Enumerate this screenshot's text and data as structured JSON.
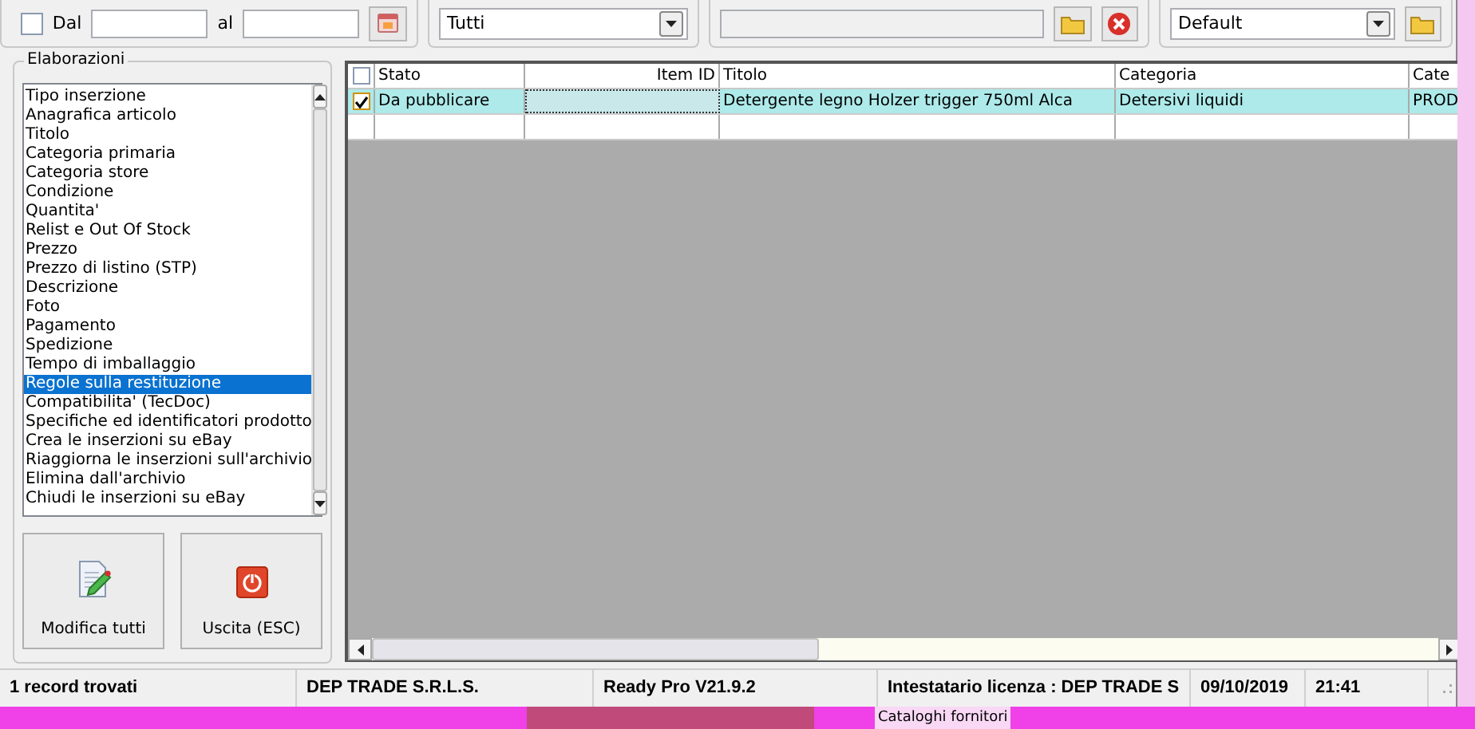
{
  "date_filter": {
    "from_label": "Dal",
    "checked": false,
    "to_label": "al"
  },
  "variant": {
    "value": "Tutti"
  },
  "view": {
    "value": "Default"
  },
  "elaborazioni": {
    "title": "Elaborazioni",
    "items": [
      {
        "label": "Tipo inserzione",
        "selected": false
      },
      {
        "label": "Anagrafica articolo",
        "selected": false
      },
      {
        "label": "Titolo",
        "selected": false
      },
      {
        "label": "Categoria primaria",
        "selected": false
      },
      {
        "label": "Categoria store",
        "selected": false
      },
      {
        "label": "Condizione",
        "selected": false
      },
      {
        "label": "Quantita'",
        "selected": false
      },
      {
        "label": "Relist e Out Of Stock",
        "selected": false
      },
      {
        "label": "Prezzo",
        "selected": false
      },
      {
        "label": "Prezzo di listino (STP)",
        "selected": false
      },
      {
        "label": "Descrizione",
        "selected": false
      },
      {
        "label": "Foto",
        "selected": false
      },
      {
        "label": "Pagamento",
        "selected": false
      },
      {
        "label": "Spedizione",
        "selected": false
      },
      {
        "label": "Tempo di imballaggio",
        "selected": false
      },
      {
        "label": "Regole sulla restituzione",
        "selected": true
      },
      {
        "label": "Compatibilita' (TecDoc)",
        "selected": false
      },
      {
        "label": "Specifiche ed identificatori prodotto",
        "selected": false
      },
      {
        "label": "Crea le inserzioni su eBay",
        "selected": false
      },
      {
        "label": "Riaggiorna le inserzioni sull'archivio",
        "selected": false
      },
      {
        "label": "Elimina dall'archivio",
        "selected": false
      },
      {
        "label": "Chiudi le inserzioni su eBay",
        "selected": false
      }
    ]
  },
  "buttons": [
    {
      "kind": "edit",
      "label": "Modifica tutti"
    },
    {
      "kind": "exit",
      "label": "Uscita (ESC)"
    }
  ],
  "table": {
    "header_checked": false,
    "columns": [
      "Stato",
      "Item ID",
      "Titolo",
      "Categoria",
      "Cate"
    ],
    "rows": [
      {
        "checked": true,
        "selected": true,
        "cells": [
          "Da pubblicare",
          null,
          "Detergente legno Holzer trigger 750ml Alca",
          "Detersivi liquidi",
          "PROD"
        ]
      }
    ]
  },
  "status_bar": [
    "1 record trovati",
    "DEP TRADE S.R.L.S.",
    "Ready Pro V21.9.2",
    "Intestatario licenza : DEP TRADE S",
    "09/10/2019",
    "21:41"
  ],
  "background": {
    "caption": "Cataloghi fornitori"
  }
}
